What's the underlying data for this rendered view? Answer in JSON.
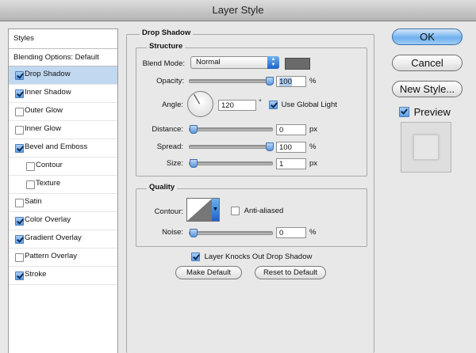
{
  "window": {
    "title": "Layer Style"
  },
  "styles_panel": {
    "header": "Styles",
    "blending_options": "Blending Options: Default",
    "items": [
      {
        "label": "Drop Shadow",
        "checked": true,
        "selected": true,
        "sub": false
      },
      {
        "label": "Inner Shadow",
        "checked": true,
        "selected": false,
        "sub": false
      },
      {
        "label": "Outer Glow",
        "checked": false,
        "selected": false,
        "sub": false
      },
      {
        "label": "Inner Glow",
        "checked": false,
        "selected": false,
        "sub": false
      },
      {
        "label": "Bevel and Emboss",
        "checked": true,
        "selected": false,
        "sub": false
      },
      {
        "label": "Contour",
        "checked": false,
        "selected": false,
        "sub": true
      },
      {
        "label": "Texture",
        "checked": false,
        "selected": false,
        "sub": true
      },
      {
        "label": "Satin",
        "checked": false,
        "selected": false,
        "sub": false
      },
      {
        "label": "Color Overlay",
        "checked": true,
        "selected": false,
        "sub": false
      },
      {
        "label": "Gradient Overlay",
        "checked": true,
        "selected": false,
        "sub": false
      },
      {
        "label": "Pattern Overlay",
        "checked": false,
        "selected": false,
        "sub": false
      },
      {
        "label": "Stroke",
        "checked": true,
        "selected": false,
        "sub": false
      }
    ]
  },
  "drop_shadow": {
    "title": "Drop Shadow",
    "structure": {
      "title": "Structure",
      "blend_mode_label": "Blend Mode:",
      "blend_mode_value": "Normal",
      "shadow_color": "#6a6a6a",
      "opacity_label": "Opacity:",
      "opacity_value": "100",
      "opacity_unit": "%",
      "opacity_level": 1.0,
      "angle_label": "Angle:",
      "angle_value": "120",
      "angle_unit": "°",
      "use_global_light_label": "Use Global Light",
      "use_global_light": true,
      "distance_label": "Distance:",
      "distance_value": "0",
      "distance_unit": "px",
      "distance_level": 0.0,
      "spread_label": "Spread:",
      "spread_value": "100",
      "spread_unit": "%",
      "spread_level": 1.0,
      "size_label": "Size:",
      "size_value": "1",
      "size_unit": "px",
      "size_level": 0.0
    },
    "quality": {
      "title": "Quality",
      "contour_label": "Contour:",
      "anti_aliased_label": "Anti-aliased",
      "anti_aliased": false,
      "noise_label": "Noise:",
      "noise_value": "0",
      "noise_unit": "%",
      "noise_level": 0.0
    },
    "knocks_out_label": "Layer Knocks Out Drop Shadow",
    "knocks_out": true,
    "make_default_label": "Make Default",
    "reset_default_label": "Reset to Default"
  },
  "buttons": {
    "ok": "OK",
    "cancel": "Cancel",
    "new_style": "New Style...",
    "preview_label": "Preview",
    "preview_checked": true
  }
}
